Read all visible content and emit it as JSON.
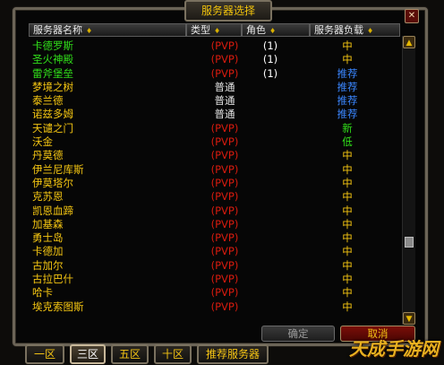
{
  "window": {
    "title": "服务器选择",
    "close_label": "✕"
  },
  "columns": {
    "name": "服务器名称",
    "type": "类型",
    "character": "角色",
    "load": "服务器负载",
    "sort_icon": "♦"
  },
  "colors": {
    "green": "#31e01a",
    "yellow": "#f5c612",
    "pvp_red": "#d81b0e",
    "recommend_blue": "#3a86ff",
    "new_green": "#31e01a",
    "medium_yellow": "#f5c612"
  },
  "servers": [
    {
      "name": "卡德罗斯",
      "name_color": "green",
      "type": "(PVP)",
      "characters": "(1)",
      "load": "中",
      "load_color": "yellow"
    },
    {
      "name": "圣火神殿",
      "name_color": "green",
      "type": "(PVP)",
      "characters": "(1)",
      "load": "中",
      "load_color": "yellow"
    },
    {
      "name": "雷斧堡垒",
      "name_color": "green",
      "type": "(PVP)",
      "characters": "(1)",
      "load": "推荐",
      "load_color": "blue"
    },
    {
      "name": "梦境之树",
      "name_color": "yellow",
      "type": "普通",
      "characters": "",
      "load": "推荐",
      "load_color": "blue"
    },
    {
      "name": "泰兰德",
      "name_color": "yellow",
      "type": "普通",
      "characters": "",
      "load": "推荐",
      "load_color": "blue"
    },
    {
      "name": "诺兹多姆",
      "name_color": "yellow",
      "type": "普通",
      "characters": "",
      "load": "推荐",
      "load_color": "blue"
    },
    {
      "name": "天谴之门",
      "name_color": "yellow",
      "type": "(PVP)",
      "characters": "",
      "load": "新",
      "load_color": "green"
    },
    {
      "name": "沃金",
      "name_color": "yellow",
      "type": "(PVP)",
      "characters": "",
      "load": "低",
      "load_color": "green"
    },
    {
      "name": "丹莫德",
      "name_color": "yellow",
      "type": "(PVP)",
      "characters": "",
      "load": "中",
      "load_color": "yellow"
    },
    {
      "name": "伊兰尼库斯",
      "name_color": "yellow",
      "type": "(PVP)",
      "characters": "",
      "load": "中",
      "load_color": "yellow"
    },
    {
      "name": "伊莫塔尔",
      "name_color": "yellow",
      "type": "(PVP)",
      "characters": "",
      "load": "中",
      "load_color": "yellow"
    },
    {
      "name": "克苏恩",
      "name_color": "yellow",
      "type": "(PVP)",
      "characters": "",
      "load": "中",
      "load_color": "yellow"
    },
    {
      "name": "凯恩血蹄",
      "name_color": "yellow",
      "type": "(PVP)",
      "characters": "",
      "load": "中",
      "load_color": "yellow"
    },
    {
      "name": "加基森",
      "name_color": "yellow",
      "type": "(PVP)",
      "characters": "",
      "load": "中",
      "load_color": "yellow"
    },
    {
      "name": "勇士岛",
      "name_color": "yellow",
      "type": "(PVP)",
      "characters": "",
      "load": "中",
      "load_color": "yellow"
    },
    {
      "name": "卡德加",
      "name_color": "yellow",
      "type": "(PVP)",
      "characters": "",
      "load": "中",
      "load_color": "yellow"
    },
    {
      "name": "古加尔",
      "name_color": "yellow",
      "type": "(PVP)",
      "characters": "",
      "load": "中",
      "load_color": "yellow"
    },
    {
      "name": "古拉巴什",
      "name_color": "yellow",
      "type": "(PVP)",
      "characters": "",
      "load": "中",
      "load_color": "yellow"
    },
    {
      "name": "哈卡",
      "name_color": "yellow",
      "type": "(PVP)",
      "characters": "",
      "load": "中",
      "load_color": "yellow"
    },
    {
      "name": "埃克索图斯",
      "name_color": "yellow",
      "type": "(PVP)",
      "characters": "",
      "load": "中",
      "load_color": "yellow"
    }
  ],
  "buttons": {
    "confirm": "确定",
    "cancel": "取消"
  },
  "tabs": [
    {
      "label": "一区",
      "active": false
    },
    {
      "label": "三区",
      "active": true
    },
    {
      "label": "五区",
      "active": false
    },
    {
      "label": "十区",
      "active": false
    },
    {
      "label": "推荐服务器",
      "active": false
    }
  ],
  "scrollbar": {
    "up_icon": "▲",
    "down_icon": "▼"
  },
  "watermark": "天成手游网"
}
